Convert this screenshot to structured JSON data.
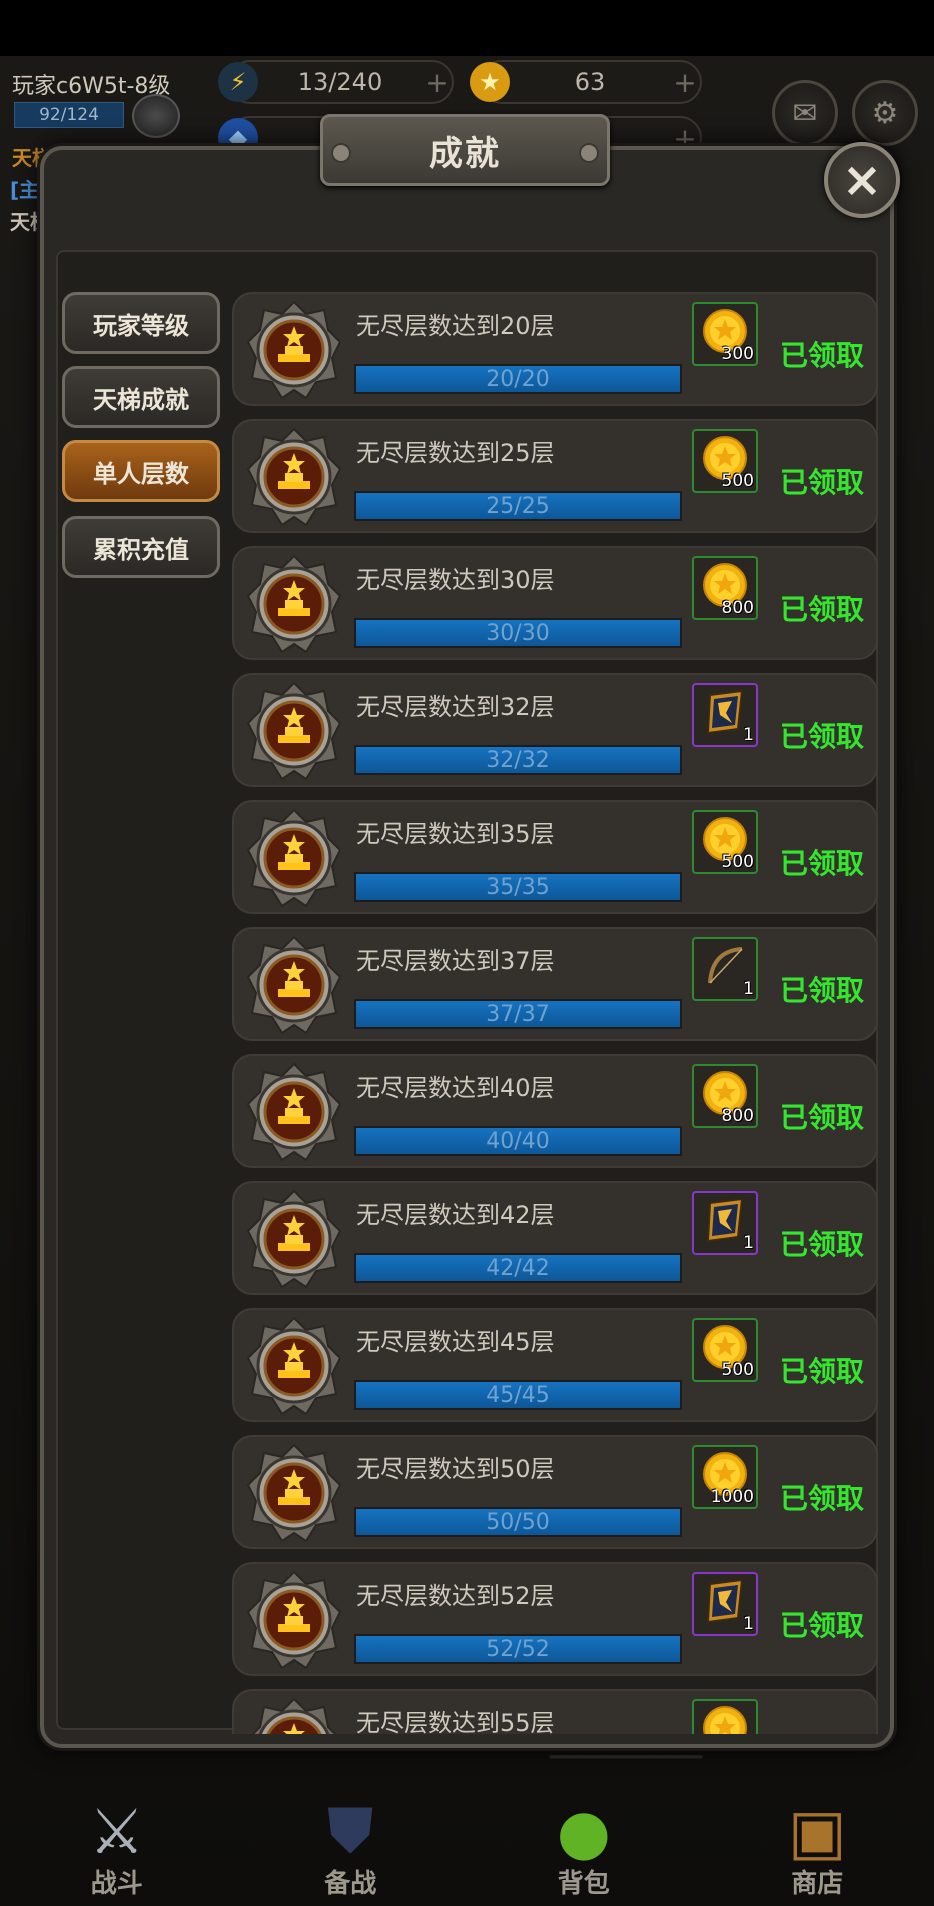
{
  "hud": {
    "player_name": "玩家c6W5t-8级",
    "xp": "92/124",
    "energy": "13/240",
    "gold": "63",
    "side_text_1": "天梯",
    "side_text_2": "[主",
    "side_text_3": "天梯"
  },
  "modal": {
    "title": "成就",
    "close_label": "×"
  },
  "tabs": [
    {
      "label": "玩家等级",
      "active": false
    },
    {
      "label": "天梯成就",
      "active": false
    },
    {
      "label": "单人层数",
      "active": true
    },
    {
      "label": "累积充值",
      "active": false
    }
  ],
  "achievements": [
    {
      "title": "无尽层数达到20层",
      "progress": "20/20",
      "ratio": 1,
      "reward": "coin",
      "qty": "300",
      "status": "已领取"
    },
    {
      "title": "无尽层数达到25层",
      "progress": "25/25",
      "ratio": 1,
      "reward": "coin",
      "qty": "500",
      "status": "已领取"
    },
    {
      "title": "无尽层数达到30层",
      "progress": "30/30",
      "ratio": 1,
      "reward": "coin",
      "qty": "800",
      "status": "已领取"
    },
    {
      "title": "无尽层数达到32层",
      "progress": "32/32",
      "ratio": 1,
      "reward": "shield",
      "qty": "1",
      "status": "已领取"
    },
    {
      "title": "无尽层数达到35层",
      "progress": "35/35",
      "ratio": 1,
      "reward": "coin",
      "qty": "500",
      "status": "已领取"
    },
    {
      "title": "无尽层数达到37层",
      "progress": "37/37",
      "ratio": 1,
      "reward": "bow",
      "qty": "1",
      "status": "已领取"
    },
    {
      "title": "无尽层数达到40层",
      "progress": "40/40",
      "ratio": 1,
      "reward": "coin",
      "qty": "800",
      "status": "已领取"
    },
    {
      "title": "无尽层数达到42层",
      "progress": "42/42",
      "ratio": 1,
      "reward": "shield",
      "qty": "1",
      "status": "已领取"
    },
    {
      "title": "无尽层数达到45层",
      "progress": "45/45",
      "ratio": 1,
      "reward": "coin",
      "qty": "500",
      "status": "已领取"
    },
    {
      "title": "无尽层数达到50层",
      "progress": "50/50",
      "ratio": 1,
      "reward": "coin",
      "qty": "1000",
      "status": "已领取"
    },
    {
      "title": "无尽层数达到52层",
      "progress": "52/52",
      "ratio": 1,
      "reward": "shield",
      "qty": "1",
      "status": "已领取"
    },
    {
      "title": "无尽层数达到55层",
      "progress": "",
      "ratio": 0,
      "reward": "coin",
      "qty": "",
      "status": ""
    }
  ],
  "bottom_nav": [
    {
      "label": "战斗",
      "icon": "crossed-swords-icon"
    },
    {
      "label": "备战",
      "icon": "shield-icon"
    },
    {
      "label": "背包",
      "icon": "potion-icon"
    },
    {
      "label": "商店",
      "icon": "treasure-chest-icon"
    }
  ],
  "colors": {
    "claimed_green": "#35e62e",
    "progress_blue": "#1673c0",
    "active_tab": "#a9621b"
  }
}
